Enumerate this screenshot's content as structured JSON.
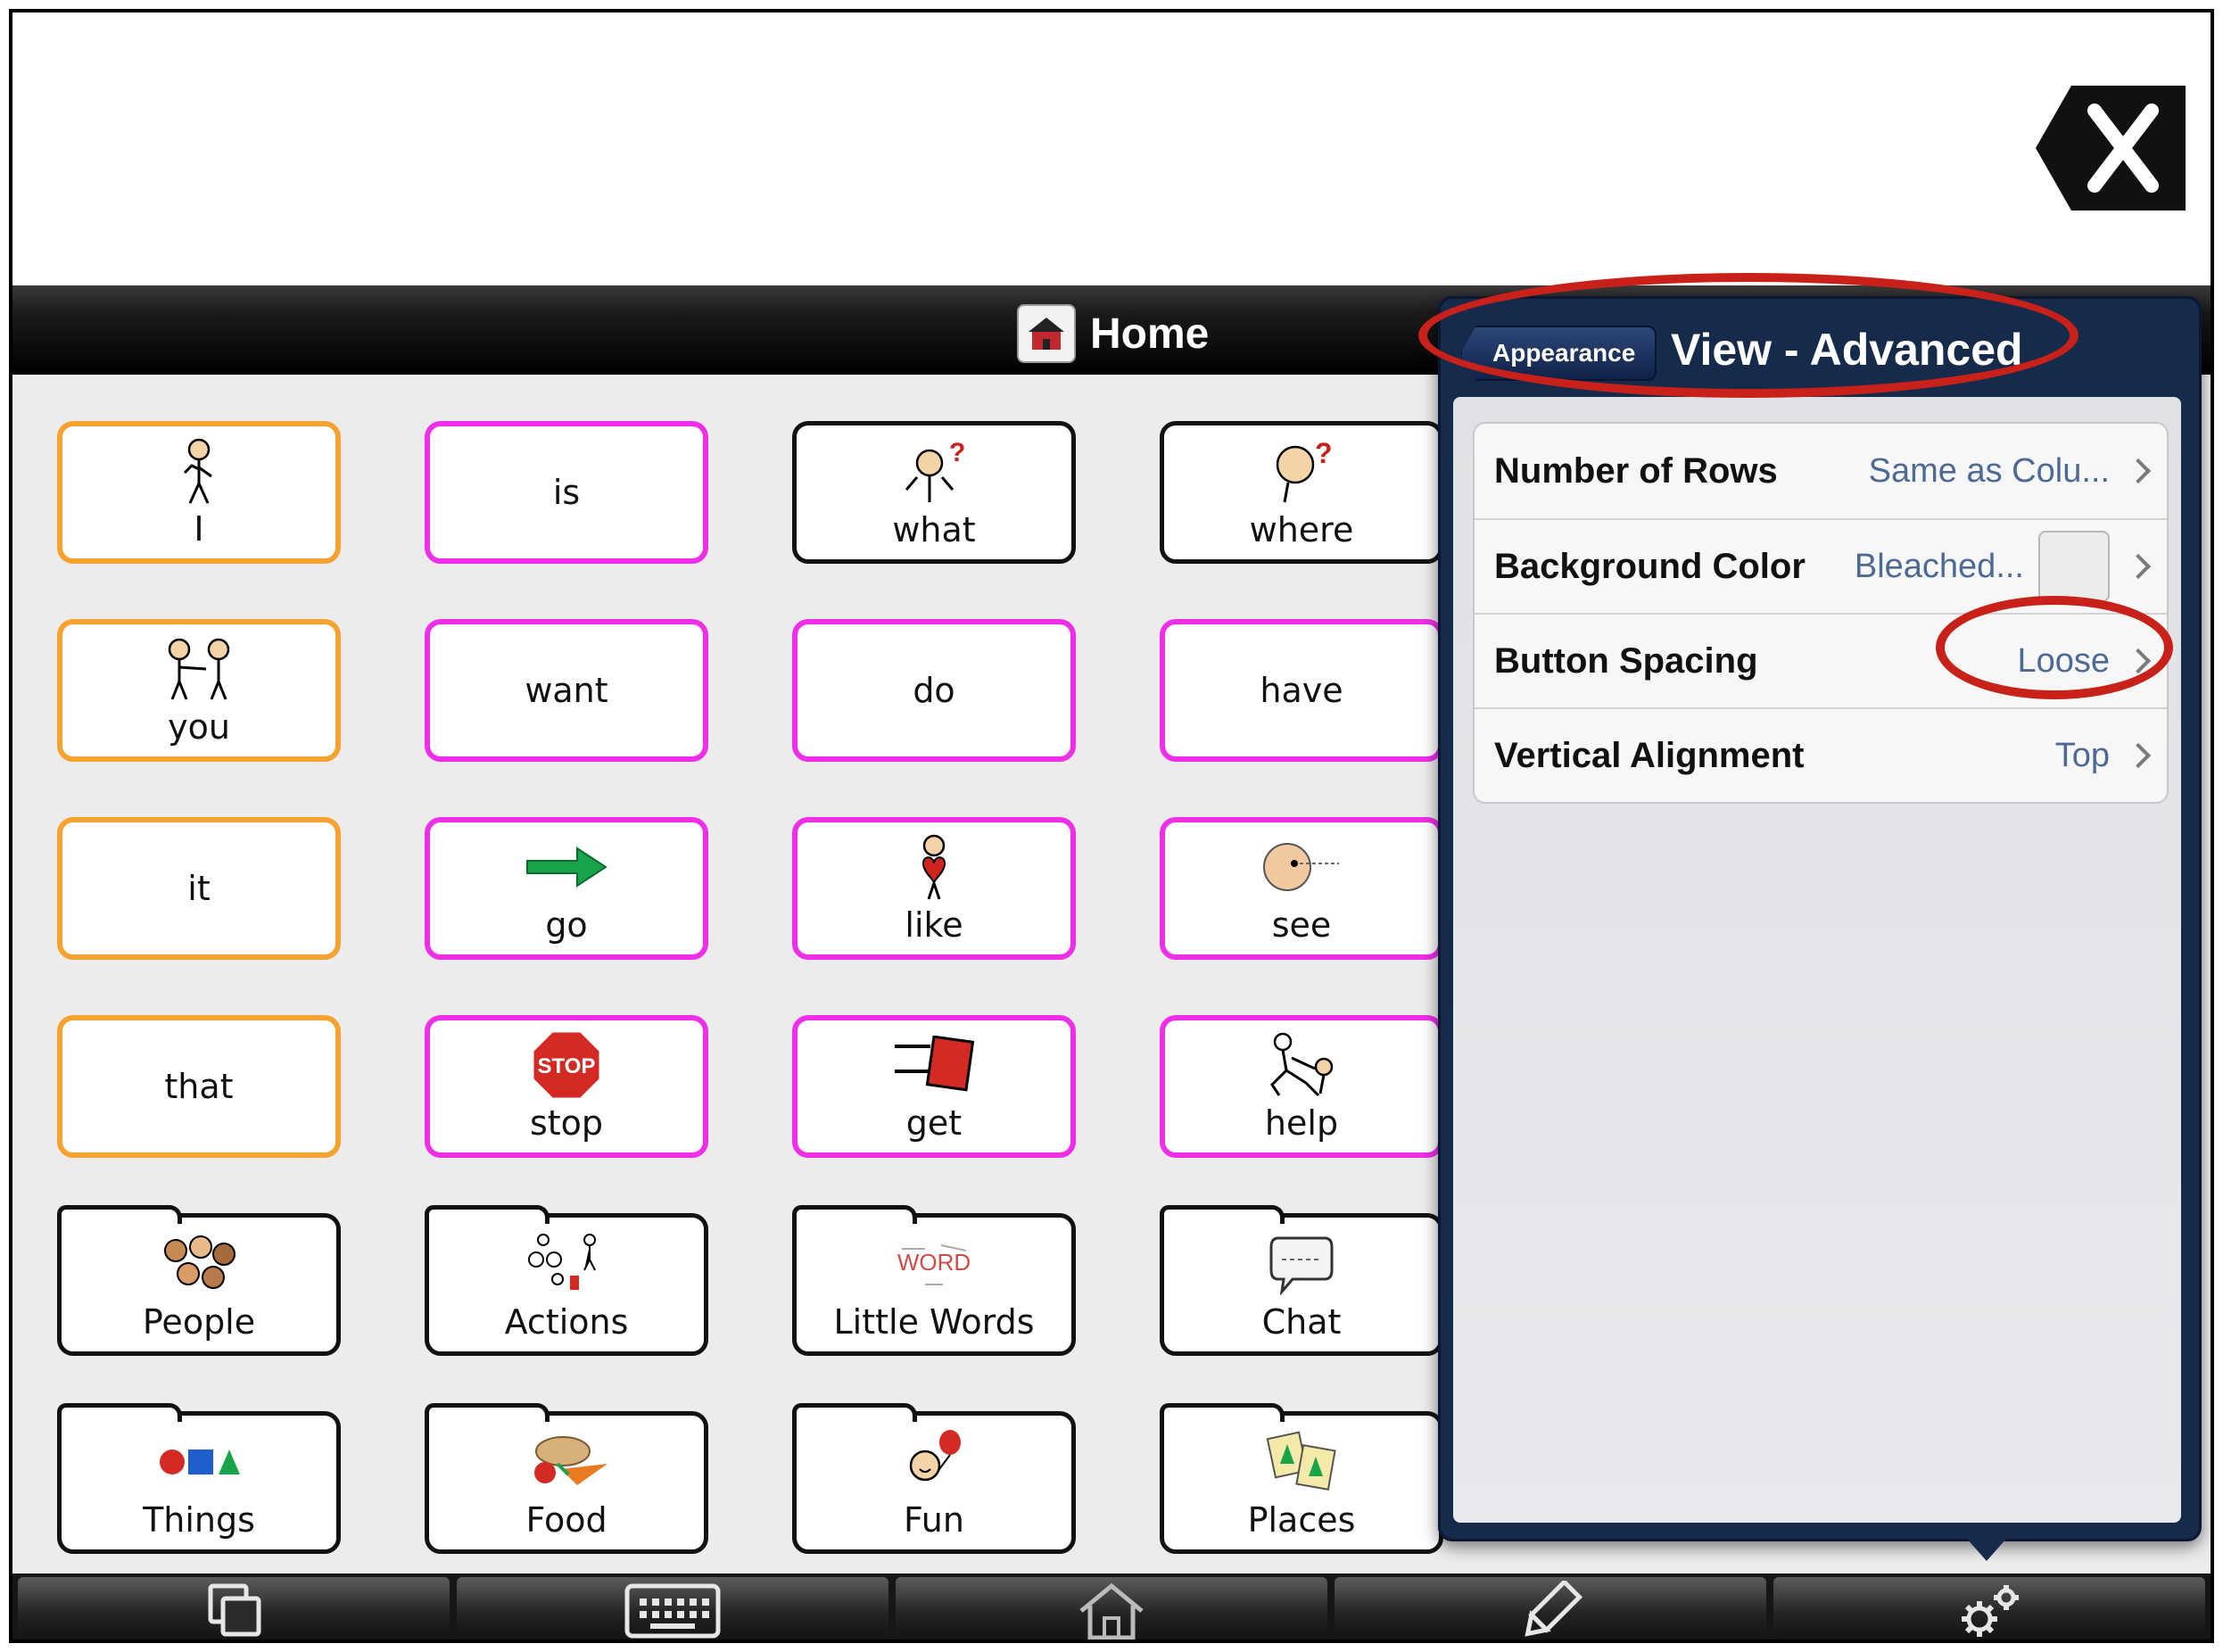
{
  "message_area": {
    "clear_icon": "close-x-icon"
  },
  "board": {
    "title": "Home",
    "title_icon": "house-icon"
  },
  "tiles": [
    {
      "label": "I"
    },
    {
      "label": "is"
    },
    {
      "label": "what"
    },
    {
      "label": "where"
    },
    {
      "label": "you"
    },
    {
      "label": "want"
    },
    {
      "label": "do"
    },
    {
      "label": "have"
    },
    {
      "label": "it"
    },
    {
      "label": "go"
    },
    {
      "label": "like"
    },
    {
      "label": "see"
    },
    {
      "label": "that"
    },
    {
      "label": "stop"
    },
    {
      "label": "get"
    },
    {
      "label": "help"
    },
    {
      "label": "People"
    },
    {
      "label": "Actions"
    },
    {
      "label": "Little Words"
    },
    {
      "label": "Chat"
    },
    {
      "label": "Things"
    },
    {
      "label": "Food"
    },
    {
      "label": "Fun"
    },
    {
      "label": "Places"
    }
  ],
  "little_words_icon_text": "WORD",
  "stop_icon_text": "STOP",
  "colors": {
    "pronoun_border": "#f7a230",
    "verb_border": "#ee2ee9",
    "folder_border": "#111111",
    "popover_bg": "#162a4c",
    "link_blue": "#4d6a95",
    "annotation_red": "#c8211a"
  },
  "popover": {
    "back_label": "Appearance",
    "title": "View - Advanced",
    "rows": [
      {
        "label": "Number of Rows",
        "value": "Same as Colu..."
      },
      {
        "label": "Background Color",
        "value": "Bleached..."
      },
      {
        "label": "Button Spacing",
        "value": "Loose"
      },
      {
        "label": "Vertical Alignment",
        "value": "Top"
      }
    ]
  },
  "toolbar": {
    "icons": [
      "copy-pages-icon",
      "keyboard-icon",
      "home-icon",
      "pencil-edit-icon",
      "gears-settings-icon"
    ]
  }
}
